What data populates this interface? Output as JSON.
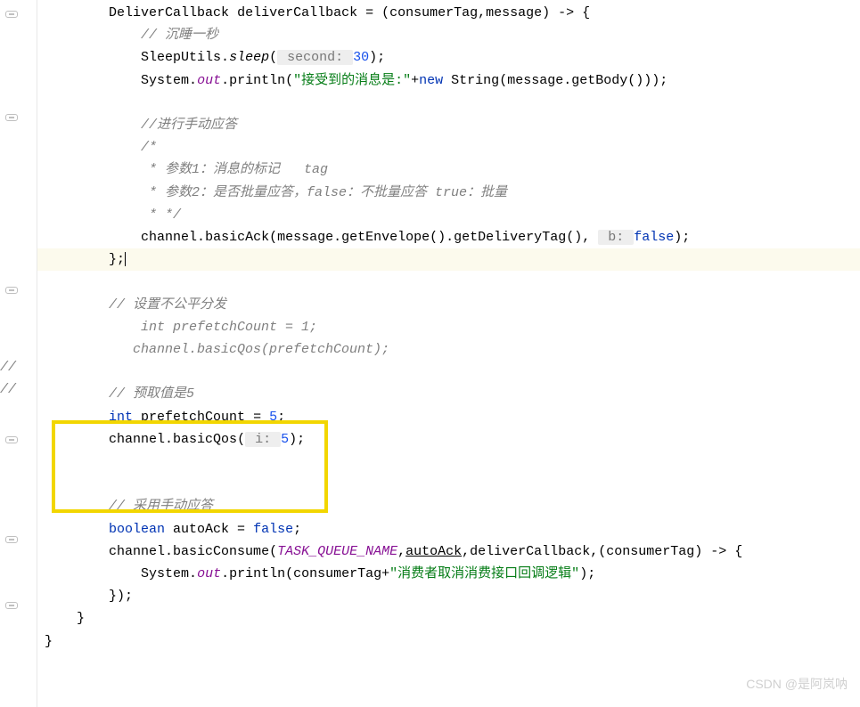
{
  "gutter_comments": [
    "//",
    "//"
  ],
  "code": {
    "l1_a": "        DeliverCallback deliverCallback = (consumerTag,message) -> {",
    "l1_parts": {
      "type": "DeliverCallback",
      "var": "deliverCallback",
      "eq": " = (",
      "p1": "consumerTag",
      "c": ",",
      "p2": "message",
      "end": ") -> {"
    },
    "l2_comment": "// 沉睡一秒",
    "l3": {
      "cls": "SleepUtils",
      "dot1": ".",
      "method": "sleep",
      "open": "(",
      "hint": " second: ",
      "num": "30",
      "close": ");"
    },
    "l4": {
      "cls": "System",
      "dot1": ".",
      "out": "out",
      "dot2": ".",
      "print": "println",
      "open": "(",
      "str": "\"接受到的消息是:\"",
      "plus": "+",
      "new": "new ",
      "strcls": "String",
      "open2": "(",
      "msg": "message",
      "dot3": ".",
      "getbody": "getBody",
      "close2": "()));"
    },
    "l6_comment": "//进行手动应答",
    "l7_comment": "/*",
    "l8_comment": " * 参数1：消息的标记   tag",
    "l9_comment": " * 参数2：是否批量应答，false：不批量应答 true：批量",
    "l10_comment": " * */",
    "l11": {
      "chan": "channel",
      "dot1": ".",
      "ack": "basicAck",
      "open": "(",
      "msg": "message",
      "dot2": ".",
      "env": "getEnvelope",
      "paren": "().",
      "tag": "getDeliveryTag",
      "paren2": "(), ",
      "hint": " b: ",
      "false": "false",
      "close": ");"
    },
    "l12": "        };",
    "l14_comment": "// 设置不公平分发",
    "l15_comment": "  int prefetchCount = 1;",
    "l16_comment": " channel.basicQos(prefetchCount);",
    "l18_comment": "// 预取值是5",
    "l19": {
      "int": "int ",
      "var": "prefetchCount",
      "eq": " = ",
      "num": "5",
      "semi": ";"
    },
    "l20": {
      "chan": "channel",
      "dot": ".",
      "qos": "basicQos",
      "open": "(",
      "hint": " i: ",
      "num": "5",
      "close": ");"
    },
    "l23_comment": "// 采用手动应答",
    "l24": {
      "bool": "boolean ",
      "var": "autoAck",
      "eq": " = ",
      "false": "false",
      "semi": ";"
    },
    "l25": {
      "chan": "channel",
      "dot": ".",
      "cons": "basicConsume",
      "open": "(",
      "queue": "TASK_QUEUE_NAME",
      "c1": ",",
      "ack": "autoAck",
      "c2": ",",
      "cb": "deliverCallback",
      "c3": ",(",
      "ct": "consumerTag",
      "arr": ") -> {"
    },
    "l26": {
      "sys": "System",
      "dot1": ".",
      "out": "out",
      "dot2": ".",
      "print": "println",
      "open": "(",
      "ct": "consumerTag",
      "plus": "+",
      "str": "\"消费者取消消费接口回调逻辑\"",
      "close": ");"
    },
    "l27": "        });",
    "l28": "    }",
    "l29": "}"
  },
  "watermark": "CSDN @是阿岚呐"
}
